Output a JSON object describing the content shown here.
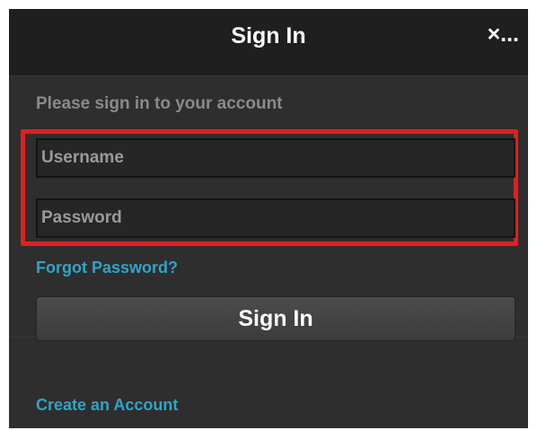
{
  "header": {
    "title": "Sign In",
    "close_label": "×..."
  },
  "form": {
    "prompt": "Please sign in to your account",
    "username_placeholder": "Username",
    "password_placeholder": "Password",
    "forgot_label": "Forgot Password?",
    "submit_label": "Sign In",
    "create_label": "Create an Account"
  },
  "colors": {
    "highlight": "#e02020",
    "link": "#33a3c6",
    "background": "#2e2e2e",
    "header": "#1f1f1f"
  }
}
